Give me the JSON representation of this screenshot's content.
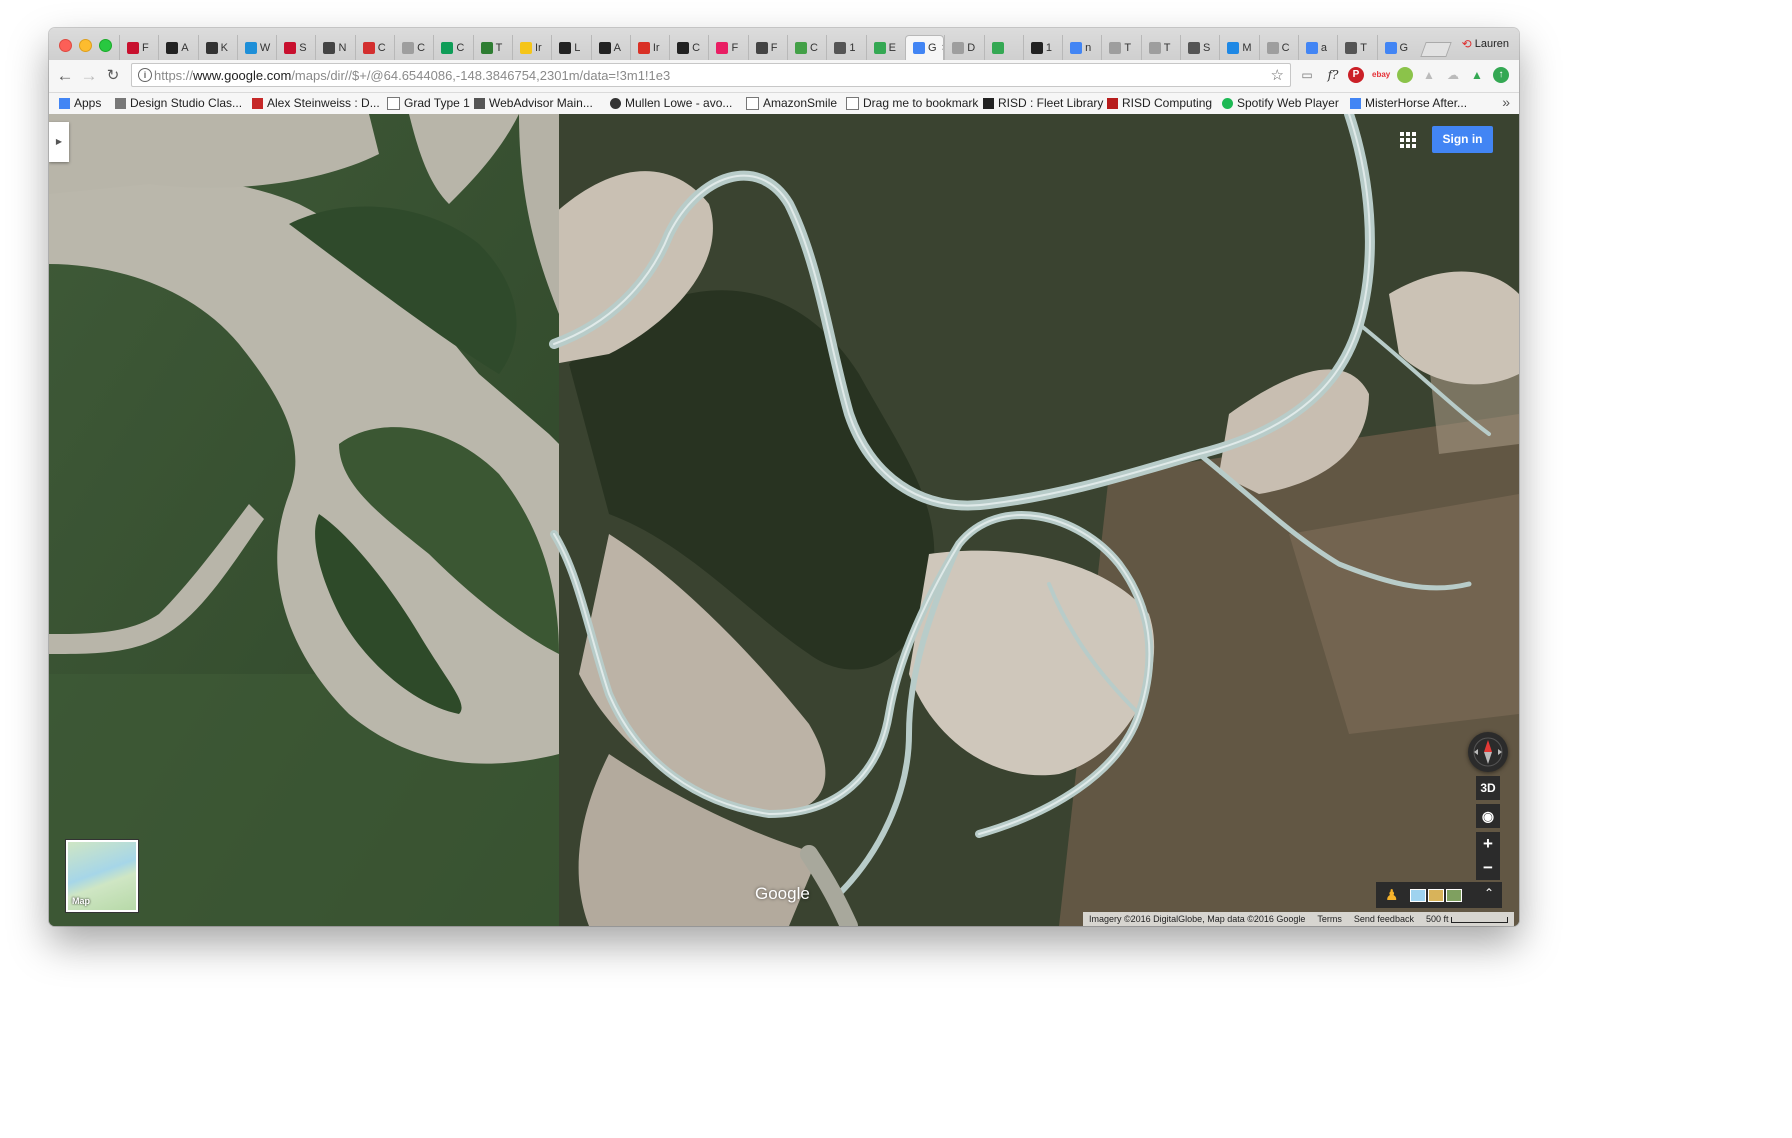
{
  "browser": {
    "tabs": [
      {
        "label": "F",
        "color": "#c8102e"
      },
      {
        "label": "A",
        "color": "#222222"
      },
      {
        "label": "K",
        "color": "#333333"
      },
      {
        "label": "W",
        "color": "#1e8fd8"
      },
      {
        "label": "S",
        "color": "#c8102e"
      },
      {
        "label": "N",
        "color": "#444444"
      },
      {
        "label": "C",
        "color": "#d32f2f"
      },
      {
        "label": "C",
        "color": "#9e9e9e"
      },
      {
        "label": "C",
        "color": "#0f9d58"
      },
      {
        "label": "T",
        "color": "#2e7d32"
      },
      {
        "label": "Ir",
        "color": "#f5c518"
      },
      {
        "label": "L",
        "color": "#222222"
      },
      {
        "label": "A",
        "color": "#222222"
      },
      {
        "label": "Ir",
        "color": "#d93025"
      },
      {
        "label": "C",
        "color": "#222222"
      },
      {
        "label": "F",
        "color": "#e91e63"
      },
      {
        "label": "F",
        "color": "#444444"
      },
      {
        "label": "C",
        "color": "#43a047"
      },
      {
        "label": "1",
        "color": "#555555"
      },
      {
        "label": "E",
        "color": "#34a853"
      },
      {
        "label": "G",
        "color": "#4285f4",
        "active": true
      },
      {
        "label": "D",
        "color": "#9e9e9e"
      },
      {
        "label": "",
        "color": "#34a853"
      },
      {
        "label": "1",
        "color": "#222222"
      },
      {
        "label": "n",
        "color": "#4285f4"
      },
      {
        "label": "T",
        "color": "#9e9e9e"
      },
      {
        "label": "T",
        "color": "#9e9e9e"
      },
      {
        "label": "S",
        "color": "#555555"
      },
      {
        "label": "M",
        "color": "#1e88e5"
      },
      {
        "label": "C",
        "color": "#9e9e9e"
      },
      {
        "label": "a",
        "color": "#4285f4"
      },
      {
        "label": "T",
        "color": "#555555"
      },
      {
        "label": "G",
        "color": "#4285f4"
      }
    ],
    "profile_name": "Lauren",
    "url_prefix": "https://",
    "url_host": "www.google.com",
    "url_path": "/maps/dir//$+/@64.6544086,-148.3846754,2301m/data=!3m1!1e3",
    "bookmarks": [
      {
        "label": "Apps",
        "icon": "apps-grid-icon"
      },
      {
        "label": "Design Studio Clas...",
        "icon": "folder-icon"
      },
      {
        "label": "Alex Steinweiss : D...",
        "icon": "bookmark-red-icon"
      },
      {
        "label": "Grad Type 1",
        "icon": "page-icon"
      },
      {
        "label": "WebAdvisor Main...",
        "icon": "webadvisor-icon"
      },
      {
        "label": "Mullen Lowe - avo...",
        "icon": "mullen-icon"
      },
      {
        "label": "AmazonSmile",
        "icon": "page-icon"
      },
      {
        "label": "Drag me to bookmark",
        "icon": "page-icon"
      },
      {
        "label": "RISD : Fleet Library",
        "icon": "risd-icon"
      },
      {
        "label": "RISD Computing",
        "icon": "risd-computing-icon"
      },
      {
        "label": "Spotify Web Player",
        "icon": "spotify-icon"
      },
      {
        "label": "MisterHorse After...",
        "icon": "google-icon"
      }
    ],
    "bookmarks_more": "»"
  },
  "map": {
    "sign_in_label": "Sign in",
    "mode_3d_label": "3D",
    "zoom_in_label": "+",
    "zoom_out_label": "−",
    "minimap_label": "Map",
    "google_logo": "Google",
    "attribution": "Imagery ©2016 DigitalGlobe, Map data ©2016 Google",
    "terms_label": "Terms",
    "feedback_label": "Send feedback",
    "scale_label": "500 ft"
  }
}
